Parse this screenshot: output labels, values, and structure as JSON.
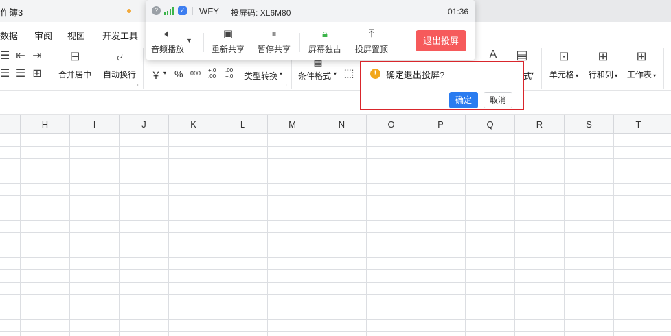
{
  "window": {
    "title": "作簿3"
  },
  "menu": [
    "数据",
    "审阅",
    "视图",
    "开发工具"
  ],
  "ribbon": {
    "merge_label": "合并居中",
    "wrap_label": "自动换行",
    "currency_symbol": "￥",
    "percent_symbol": "%",
    "thousands_symbol": "000",
    "dec_increase": "+.0 .00",
    "dec_decrease": ".00 +.0",
    "type_convert_label": "类型转换",
    "cond_format_label": "条件格式",
    "cell_label": "单元格",
    "row_col_label": "行和列",
    "sheet_label": "工作表",
    "style_label_partial": "式"
  },
  "share_bar": {
    "user": "WFY",
    "code_label": "投屏码:",
    "code_value": "XL6M80",
    "time": "01:36",
    "buttons": [
      {
        "label": "音频播放",
        "icon": "speaker-icon"
      },
      {
        "label": "重新共享",
        "icon": "monitor-upload-icon"
      },
      {
        "label": "暂停共享",
        "icon": "pause-icon"
      },
      {
        "label": "屏幕独占",
        "icon": "lock-icon"
      },
      {
        "label": "投屏置顶",
        "icon": "pin-top-icon"
      }
    ],
    "exit_label": "退出投屏",
    "exit_color": "#f65a5b"
  },
  "dialog": {
    "message": "确定退出投屏?",
    "ok_label": "确定",
    "cancel_label": "取消",
    "icon": "!"
  },
  "grid": {
    "columns": [
      "H",
      "I",
      "J",
      "K",
      "L",
      "M",
      "N",
      "O",
      "P",
      "Q",
      "R",
      "S",
      "T"
    ]
  }
}
